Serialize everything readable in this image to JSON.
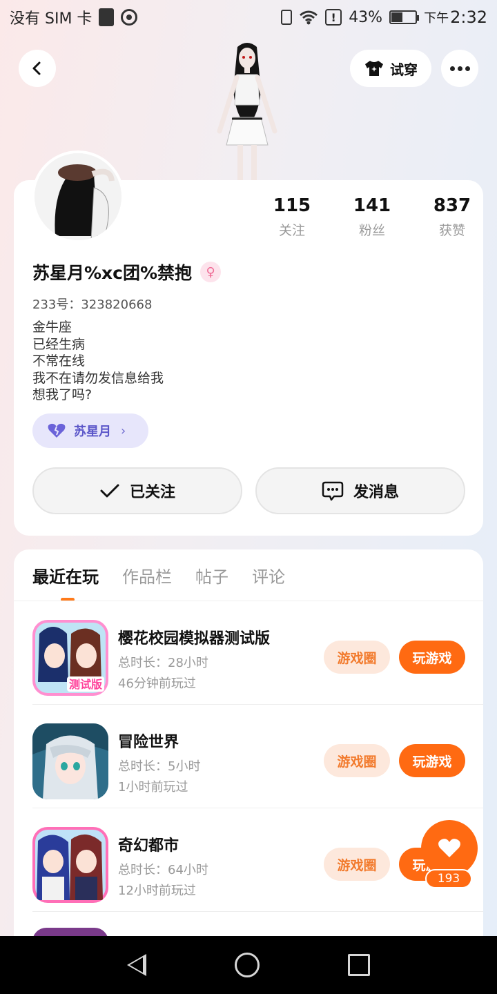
{
  "status_bar": {
    "carrier": "没有 SIM 卡",
    "battery_percent": "43%",
    "time_prefix": "下午",
    "time": "2:32"
  },
  "header": {
    "tryon_label": "试穿"
  },
  "profile": {
    "stats": [
      {
        "value": "115",
        "label": "关注"
      },
      {
        "value": "141",
        "label": "粉丝"
      },
      {
        "value": "837",
        "label": "获赞"
      }
    ],
    "username": "苏星月%xc团%禁抱",
    "gender_symbol": "♀",
    "uid": "233号：323820668",
    "bio": [
      "金牛座",
      "已经生病",
      "不常在线",
      "我不在请勿发信息给我",
      "想我了吗?"
    ],
    "role_tag": "苏星月",
    "follow_label": "已关注",
    "message_label": "发消息"
  },
  "tabs": [
    "最近在玩",
    "作品栏",
    "帖子",
    "评论"
  ],
  "games": [
    {
      "name": "樱花校园模拟器测试版",
      "duration": "总时长：28小时",
      "last_played": "46分钟前玩过",
      "circle_label": "游戏圈",
      "play_label": "玩游戏"
    },
    {
      "name": "冒险世界",
      "duration": "总时长：5小时",
      "last_played": "1小时前玩过",
      "circle_label": "游戏圈",
      "play_label": "玩游戏"
    },
    {
      "name": "奇幻都市",
      "duration": "总时长：64小时",
      "last_played": "12小时前玩过",
      "circle_label": "游戏圈",
      "play_label": "玩游戏"
    }
  ],
  "fab": {
    "count": "193"
  },
  "colors": {
    "accent": "#ff6a12",
    "role_tag_text": "#5b56c9",
    "gender": "#ef6b95"
  }
}
